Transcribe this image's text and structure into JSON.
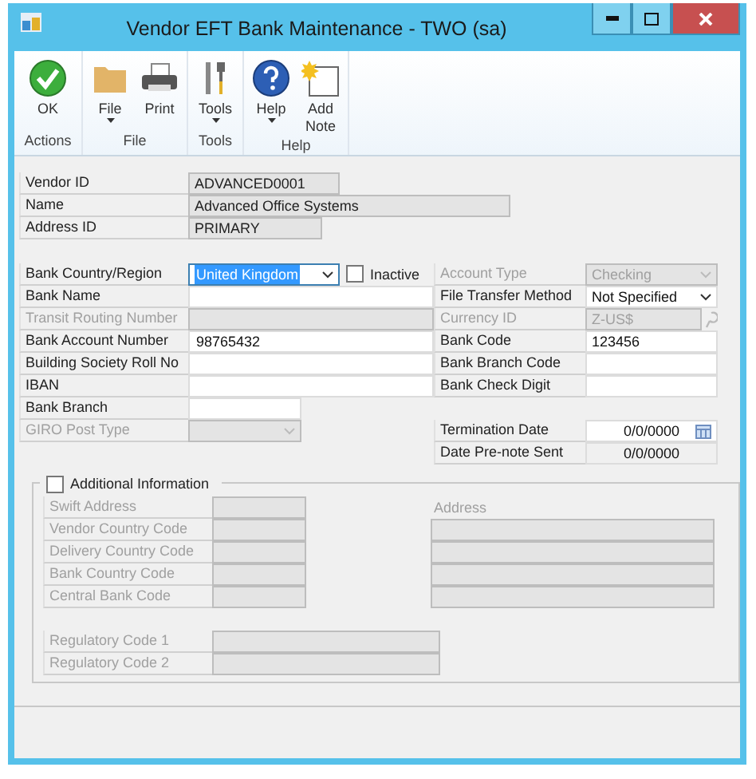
{
  "window": {
    "title": "Vendor EFT Bank Maintenance  -  TWO (sa)"
  },
  "ribbon": {
    "groups": [
      {
        "label": "Actions",
        "buttons": [
          {
            "label": "OK",
            "dropdown": false
          }
        ]
      },
      {
        "label": "File",
        "buttons": [
          {
            "label": "File",
            "dropdown": true
          },
          {
            "label": "Print",
            "dropdown": false
          }
        ]
      },
      {
        "label": "Tools",
        "buttons": [
          {
            "label": "Tools",
            "dropdown": true
          }
        ]
      },
      {
        "label": "Help",
        "buttons": [
          {
            "label": "Help",
            "dropdown": true
          },
          {
            "label": "Add Note",
            "dropdown": false
          }
        ]
      }
    ]
  },
  "vendor": [
    {
      "label": "Vendor ID",
      "value": "ADVANCED0001"
    },
    {
      "label": "Name",
      "value": "Advanced Office Systems"
    },
    {
      "label": "Address ID",
      "value": "PRIMARY"
    }
  ],
  "bank_left": [
    {
      "label": "Bank Country/Region",
      "kind": "dropdown",
      "value": "United Kingdom",
      "disabled": false,
      "focused": true
    },
    {
      "label": "Bank Name",
      "kind": "text",
      "disabled": false,
      "focused": false
    },
    {
      "label": "Transit Routing Number",
      "kind": "text",
      "disabled": true,
      "focused": false
    },
    {
      "label": "Bank Account Number",
      "kind": "text",
      "value": "98765432",
      "disabled": false,
      "focused": false
    },
    {
      "label": "Building Society Roll No",
      "kind": "text",
      "disabled": false,
      "focused": false
    },
    {
      "label": "IBAN",
      "kind": "text",
      "disabled": false,
      "focused": false
    },
    {
      "label": "Bank Branch",
      "kind": "text",
      "disabled": false,
      "focused": false
    },
    {
      "label": "GIRO Post Type",
      "kind": "dropdown",
      "disabled": true,
      "focused": false
    }
  ],
  "inactive": {
    "label": "Inactive",
    "checked": false
  },
  "bank_right": [
    {
      "label": "Account Type",
      "kind": "dropdown",
      "value": "Checking",
      "disabled": true
    },
    {
      "label": "File Transfer Method",
      "kind": "dropdown",
      "value": "Not Specified",
      "disabled": false
    },
    {
      "label": "Currency ID",
      "kind": "lookup",
      "value": "Z-US$",
      "disabled": true
    },
    {
      "label": "Bank Code",
      "kind": "text",
      "value": "123456",
      "disabled": false
    },
    {
      "label": "Bank Branch Code",
      "kind": "text",
      "disabled": false
    },
    {
      "label": "Bank Check Digit",
      "kind": "text",
      "disabled": false
    }
  ],
  "dates": [
    {
      "label": "Termination Date",
      "kind": "date",
      "value": "0/0/0000"
    },
    {
      "label": "Date Pre-note Sent",
      "kind": "text",
      "value": "0/0/0000"
    }
  ],
  "additional": {
    "label": "Additional Information",
    "checked": false,
    "codes": [
      {
        "label": "Swift Address"
      },
      {
        "label": "Vendor Country Code"
      },
      {
        "label": "Delivery Country Code"
      },
      {
        "label": "Bank Country Code"
      },
      {
        "label": "Central Bank Code"
      }
    ],
    "address_label": "Address",
    "regulatory": [
      {
        "label": "Regulatory Code 1"
      },
      {
        "label": "Regulatory Code 2"
      }
    ]
  }
}
